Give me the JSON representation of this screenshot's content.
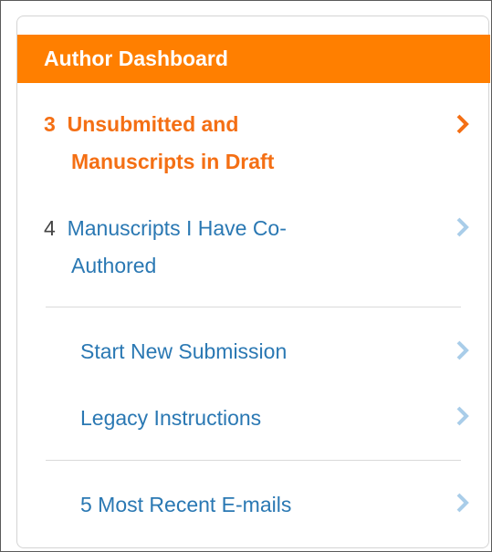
{
  "dashboard": {
    "title": "Author Dashboard",
    "items": [
      {
        "count": "3",
        "label": "Unsubmitted and Manuscripts in Draft",
        "line1": "Unsubmitted and",
        "line2": "Manuscripts in Draft"
      },
      {
        "count": "4",
        "label": "Manuscripts I Have Co-Authored",
        "line1": "Manuscripts I Have Co-",
        "line2": "Authored"
      }
    ],
    "links": [
      {
        "label": "Start New Submission"
      },
      {
        "label": "Legacy Instructions"
      },
      {
        "label": "5 Most Recent E-mails"
      }
    ]
  },
  "colors": {
    "header_bg": "#ff7f00",
    "active_text": "#f46f14",
    "link_text": "#2a78b3",
    "chevron_inactive": "#a9cde9",
    "chevron_active": "#f46f14"
  },
  "icons": {
    "chevron": "chevron-right-icon"
  }
}
